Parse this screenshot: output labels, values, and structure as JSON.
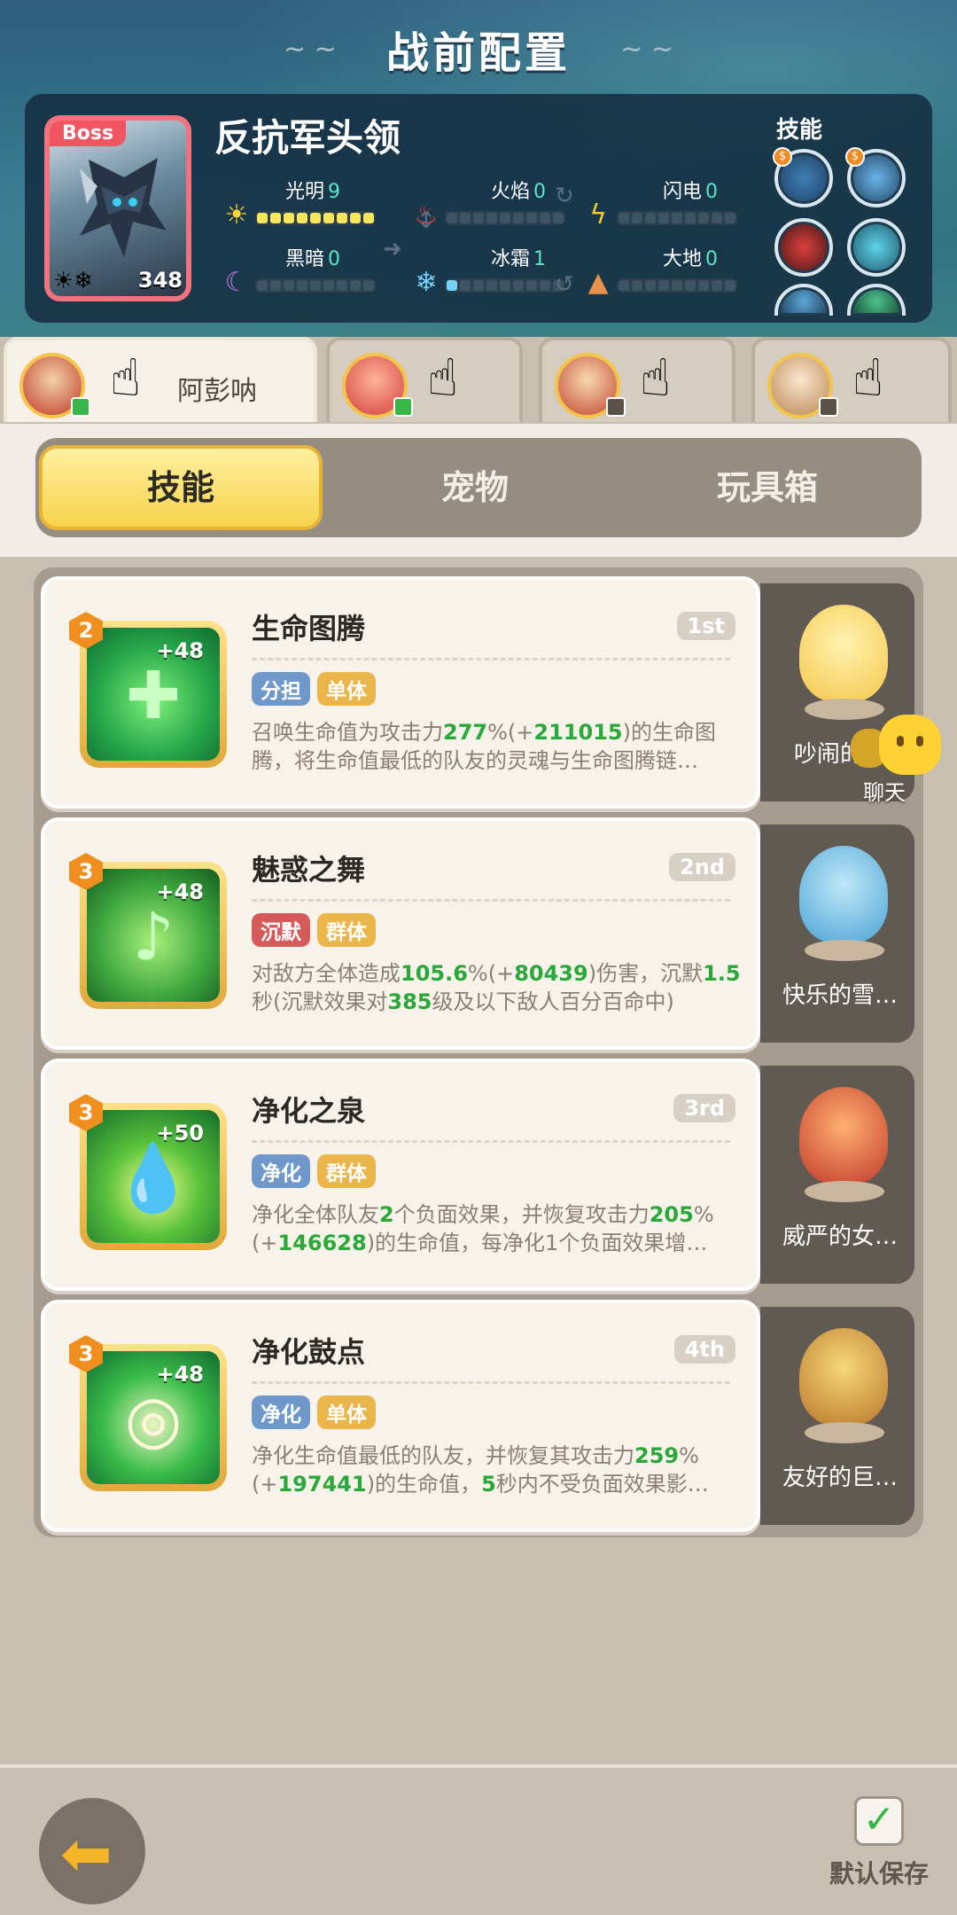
{
  "header": {
    "title": "战前配置"
  },
  "boss": {
    "tag": "Boss",
    "name": "反抗军头领",
    "level": "348",
    "elements": [
      {
        "label": "光明",
        "value": "9",
        "icon": "sun",
        "filled": 9,
        "color": "#f7e65c"
      },
      {
        "label": "火焰",
        "value": "0",
        "icon": "fire",
        "filled": 0,
        "color": "#ef5661"
      },
      {
        "label": "闪电",
        "value": "0",
        "icon": "lightning",
        "filled": 0,
        "color": "#f7d34b"
      },
      {
        "label": "黑暗",
        "value": "0",
        "icon": "moon",
        "filled": 0,
        "color": "#b47bd6"
      },
      {
        "label": "冰霜",
        "value": "1",
        "icon": "snowflake",
        "filled": 1,
        "color": "#74d1f7"
      },
      {
        "label": "大地",
        "value": "0",
        "icon": "mountain",
        "filled": 0,
        "color": "#e8914c"
      }
    ],
    "skills_label": "技能"
  },
  "heroes": [
    {
      "name": "阿彭呐",
      "active": true
    },
    {
      "name": "",
      "active": false
    },
    {
      "name": "",
      "active": false
    },
    {
      "name": "",
      "active": false
    }
  ],
  "tabs": [
    {
      "label": "技能",
      "active": true
    },
    {
      "label": "宠物",
      "active": false
    },
    {
      "label": "玩具箱",
      "active": false
    }
  ],
  "skills": [
    {
      "level": "2",
      "bonus": "+48",
      "title": "生命图腾",
      "order": "1st",
      "tags": [
        {
          "text": "分担",
          "style": "blue"
        },
        {
          "text": "单体",
          "style": "gold"
        }
      ],
      "desc": [
        "召唤生命值为攻击力",
        {
          "g": "277"
        },
        "%(+",
        {
          "g": "211015"
        },
        ")的生命图腾，将生命值最低的队友的灵魂与生命图腾链…"
      ],
      "pet_name": "吵闹的…"
    },
    {
      "level": "3",
      "bonus": "+48",
      "title": "魅惑之舞",
      "order": "2nd",
      "tags": [
        {
          "text": "沉默",
          "style": "red"
        },
        {
          "text": "群体",
          "style": "gold"
        }
      ],
      "desc": [
        "对敌方全体造成",
        {
          "g": "105.6"
        },
        "%(+",
        {
          "g": "80439"
        },
        ")伤害，沉默",
        {
          "g": "1.5"
        },
        "秒(沉默效果对",
        {
          "g": "385"
        },
        "级及以下敌人百分百命中)"
      ],
      "pet_name": "快乐的雪…"
    },
    {
      "level": "3",
      "bonus": "+50",
      "title": "净化之泉",
      "order": "3rd",
      "tags": [
        {
          "text": "净化",
          "style": "blue"
        },
        {
          "text": "群体",
          "style": "gold"
        }
      ],
      "desc": [
        "净化全体队友",
        {
          "g": "2"
        },
        "个负面效果，并恢复攻击力",
        {
          "g": "205"
        },
        "%(+",
        {
          "g": "146628"
        },
        ")的生命值，每净化1个负面效果增…"
      ],
      "pet_name": "威严的女…"
    },
    {
      "level": "3",
      "bonus": "+48",
      "title": "净化鼓点",
      "order": "4th",
      "tags": [
        {
          "text": "净化",
          "style": "blue"
        },
        {
          "text": "单体",
          "style": "gold"
        }
      ],
      "desc": [
        "净化生命值最低的队友，并恢复其攻击力",
        {
          "g": "259"
        },
        "%(+",
        {
          "g": "197441"
        },
        ")的生命值，",
        {
          "g": "5"
        },
        "秒内不受负面效果影…"
      ],
      "pet_name": "友好的巨…"
    }
  ],
  "chat": {
    "label": "聊天"
  },
  "bottom": {
    "save_label": "默认保存"
  }
}
